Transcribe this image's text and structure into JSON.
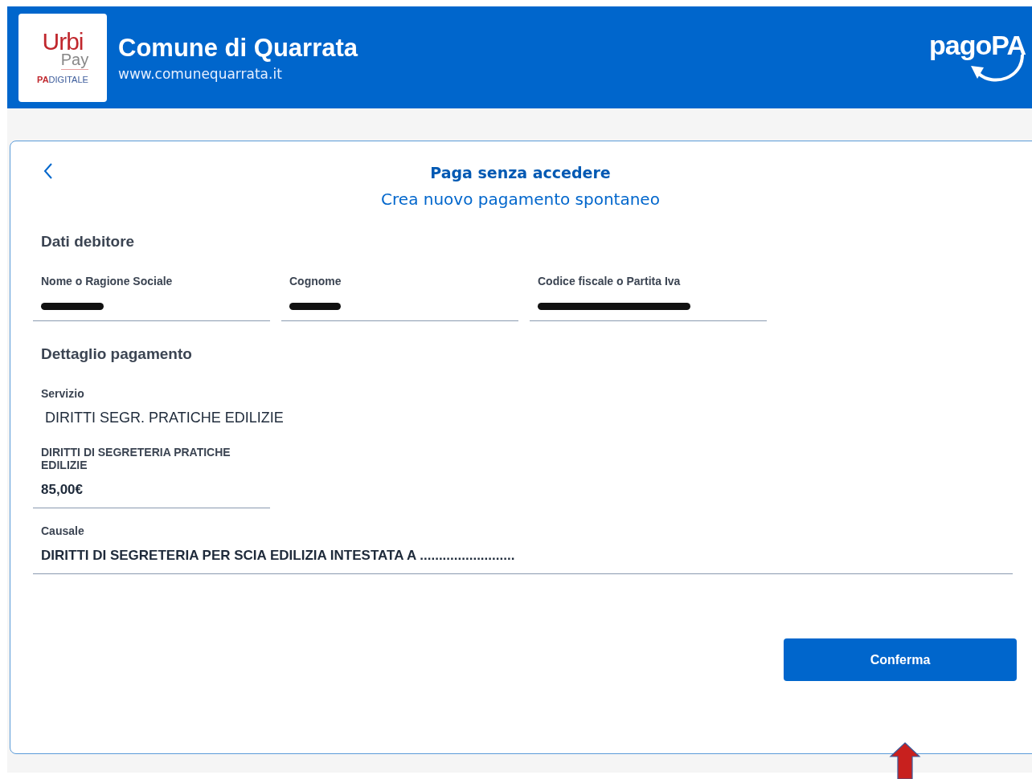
{
  "header": {
    "logo": {
      "brand": "Urbi",
      "sub": "Pay",
      "tagline_pa": "PA",
      "tagline_rest": "DIGITALE"
    },
    "title": "Comune di Quarrata",
    "website": "www.comunequarrata.it",
    "payment_logo": "pagoPA"
  },
  "card": {
    "title": "Paga senza accedere",
    "subtitle": "Crea nuovo pagamento spontaneo",
    "sections": [
      {
        "heading": "Dati debitore",
        "kind": "row",
        "fields": [
          {
            "label": "Nome o Ragione Sociale",
            "redacted": true
          },
          {
            "label": "Cognome",
            "redacted": true
          },
          {
            "label": "Codice fiscale o Partita Iva",
            "redacted": true
          }
        ]
      },
      {
        "heading": "Dettaglio pagamento",
        "kind": "stack",
        "fields": [
          {
            "label": "Servizio",
            "value": "DIRITTI SEGR. PRATICHE EDILIZIE",
            "kind": "static"
          },
          {
            "label": "DIRITTI DI SEGRETERIA PRATICHE EDILIZIE",
            "value": "85,00€",
            "kind": "short"
          },
          {
            "label": "Causale",
            "value": "DIRITTI DI SEGRETERIA PER SCIA EDILIZIA INTESTATA A .........................",
            "kind": "wide"
          }
        ]
      }
    ],
    "button": "Conferma"
  }
}
